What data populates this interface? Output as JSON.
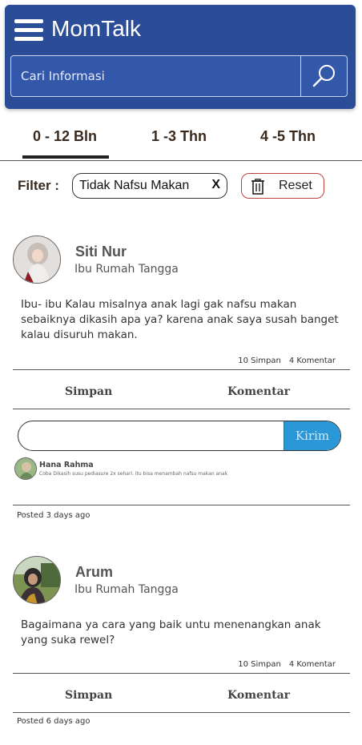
{
  "header": {
    "title": "MomTalk",
    "search_placeholder": "Cari Informasi",
    "accent_color": "#2b4c96"
  },
  "tabs": [
    {
      "label": "0 - 12 Bln",
      "active": true
    },
    {
      "label": "1 -3 Thn",
      "active": false
    },
    {
      "label": "4 -5 Thn",
      "active": false
    }
  ],
  "filter": {
    "label": "Filter :",
    "chip_label": "Tidak Nafsu Makan",
    "chip_remove": "X",
    "reset_label": "Reset"
  },
  "posts": [
    {
      "author": "Siti Nur",
      "role": "Ibu Rumah Tangga",
      "text": "Ibu- ibu Kalau misalnya anak lagi gak nafsu makan sebaiknya dikasih apa ya? karena anak saya susah banget kalau disuruh makan.",
      "saves": "10 Simpan",
      "comments_count": "4 Komentar",
      "save_label": "Simpan",
      "comment_label": "Komentar",
      "send_label": "Kirim",
      "comment": {
        "author": "Hana Rahma",
        "text": "Coba Dikasih susu pediasure 2x sehari. itu bisa menambah nafsu makan anak"
      },
      "posted": "Posted 3 days ago"
    },
    {
      "author": "Arum",
      "role": "Ibu Rumah Tangga",
      "text": "Bagaimana ya cara yang baik untu menenangkan anak yang suka rewel?",
      "saves": "10 Simpan",
      "comments_count": "4 Komentar",
      "save_label": "Simpan",
      "comment_label": "Komentar",
      "posted": "Posted 6 days ago"
    }
  ]
}
